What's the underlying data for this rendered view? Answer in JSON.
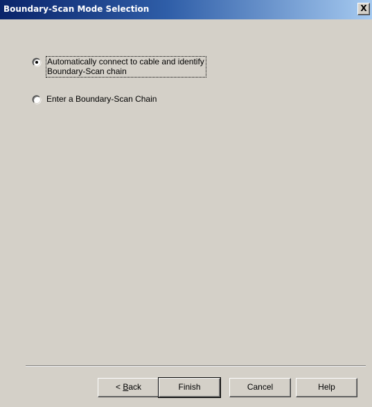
{
  "window": {
    "title": "Boundary-Scan Mode Selection",
    "close_glyph": "X"
  },
  "options": {
    "auto": {
      "line1": "Automatically connect to cable and identify",
      "line2": "Boundary-Scan chain",
      "selected": true
    },
    "manual": {
      "label": "Enter a Boundary-Scan Chain",
      "selected": false
    }
  },
  "buttons": {
    "back_prefix": "< ",
    "back_mnemonic": "B",
    "back_rest": "ack",
    "finish": "Finish",
    "cancel": "Cancel",
    "help": "Help"
  },
  "icons": {
    "close": "close-icon"
  }
}
